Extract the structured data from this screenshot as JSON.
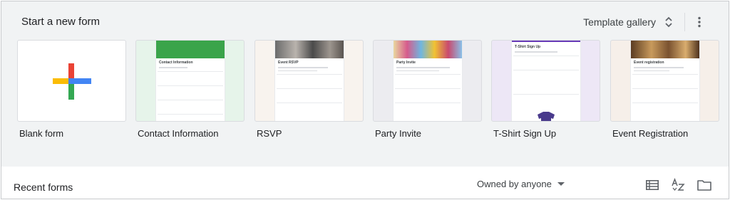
{
  "templates": {
    "title": "Start a new form",
    "gallery_label": "Template gallery",
    "items": [
      {
        "label": "Blank form"
      },
      {
        "label": "Contact Information",
        "form_title": "Contact Information"
      },
      {
        "label": "RSVP",
        "form_title": "Event RSVP"
      },
      {
        "label": "Party Invite",
        "form_title": "Party Invite"
      },
      {
        "label": "T-Shirt Sign Up",
        "form_title": "T-Shirt Sign Up"
      },
      {
        "label": "Event Registration",
        "form_title": "Event registration"
      }
    ]
  },
  "recent": {
    "title": "Recent forms",
    "owner_filter": "Owned by anyone"
  },
  "icons": [
    "plus-icon",
    "unfold-more-icon",
    "more-vert-icon",
    "chevron-down-icon",
    "list-view-icon",
    "sort-az-icon",
    "folder-icon"
  ],
  "colors": {
    "plus_red": "#ea4335",
    "plus_blue": "#4285f4",
    "plus_green": "#34a853",
    "plus_yellow": "#fbbc04",
    "contact_banner": "#3aa44a",
    "tshirt_accent": "#673ab7"
  }
}
